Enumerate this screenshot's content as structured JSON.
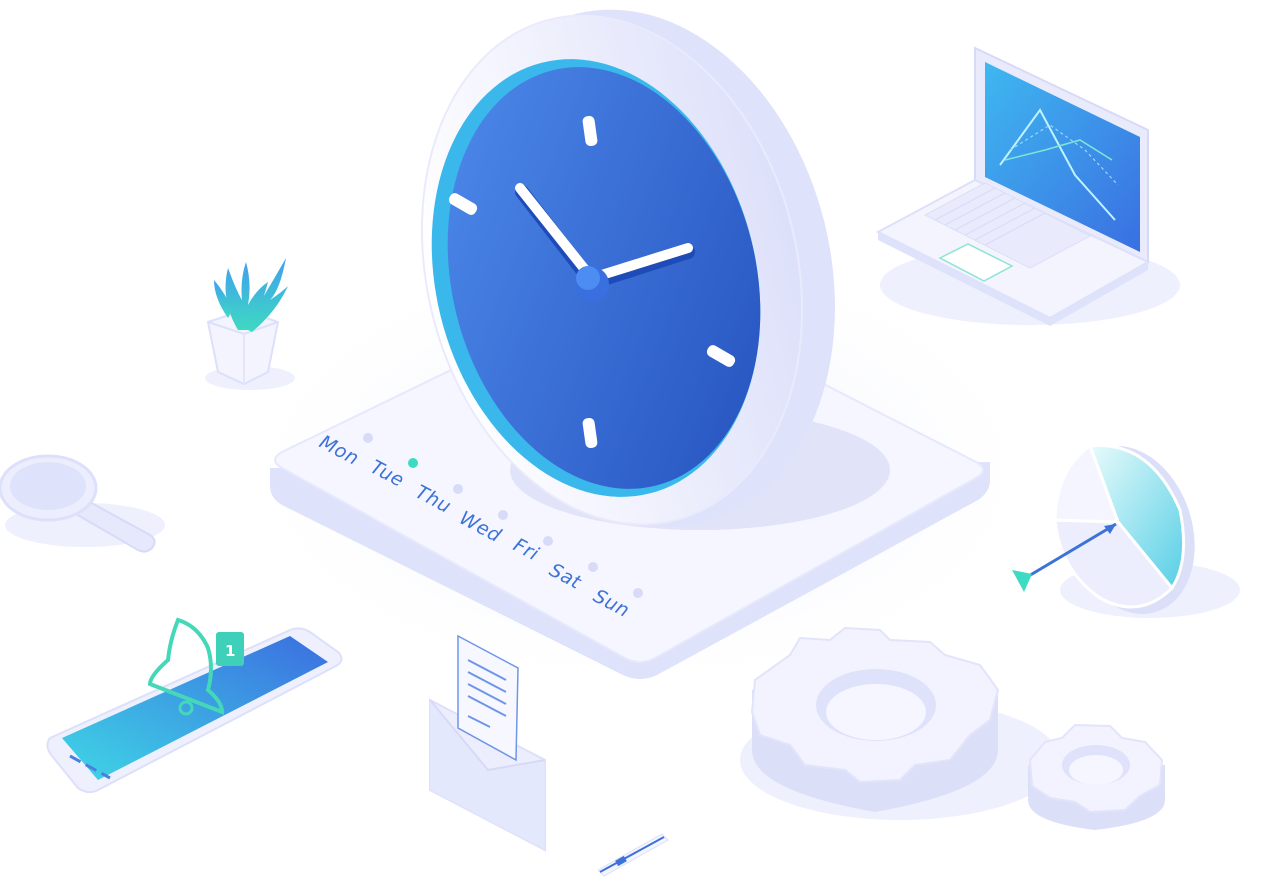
{
  "colors": {
    "background": "#ffffff",
    "surface": "#f4f5ff",
    "surface_edge": "#dcdff8",
    "surface_shadow": "#c9cdf2",
    "clock_face_light": "#4a86e8",
    "clock_face_dark": "#2855c4",
    "accent_teal": "#3ddbc1",
    "accent_cyan": "#49c6f0",
    "label_blue": "#3d72d8"
  },
  "calendar": {
    "days": [
      {
        "label": "Mon",
        "active": false
      },
      {
        "label": "Tue",
        "active": true
      },
      {
        "label": "Thu",
        "active": false
      },
      {
        "label": "Wed",
        "active": false
      },
      {
        "label": "Fri",
        "active": false
      },
      {
        "label": "Sat",
        "active": false
      },
      {
        "label": "Sun",
        "active": false
      }
    ]
  },
  "phone": {
    "notification_count": "1"
  },
  "icons": [
    "clock-icon",
    "laptop-icon",
    "plant-icon",
    "magnifier-icon",
    "smartphone-icon",
    "bell-icon",
    "envelope-icon",
    "document-icon",
    "pen-icon",
    "gear-icon",
    "pie-chart-icon",
    "arrow-icon"
  ]
}
